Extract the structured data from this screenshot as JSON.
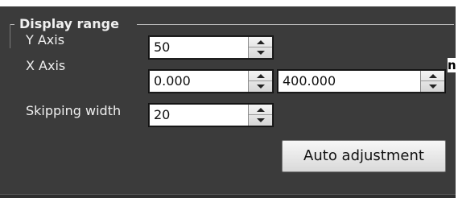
{
  "group": {
    "title": "Display range"
  },
  "fields": {
    "y_axis": {
      "label": "Y Axis",
      "value": "50"
    },
    "x_axis": {
      "label": "X Axis",
      "min_value": "0.000",
      "max_value": "400.000"
    },
    "skipping_width": {
      "label": "Skipping width",
      "value": "20"
    }
  },
  "buttons": {
    "auto_adjustment": "Auto adjustment"
  },
  "clipped_text": "n",
  "colors": {
    "panel_bg": "#3b3b3b",
    "label_text": "#f0f0f0",
    "field_bg": "#ffffff"
  },
  "icons": {
    "spin_up": "arrow-up-icon",
    "spin_down": "arrow-down-icon"
  }
}
